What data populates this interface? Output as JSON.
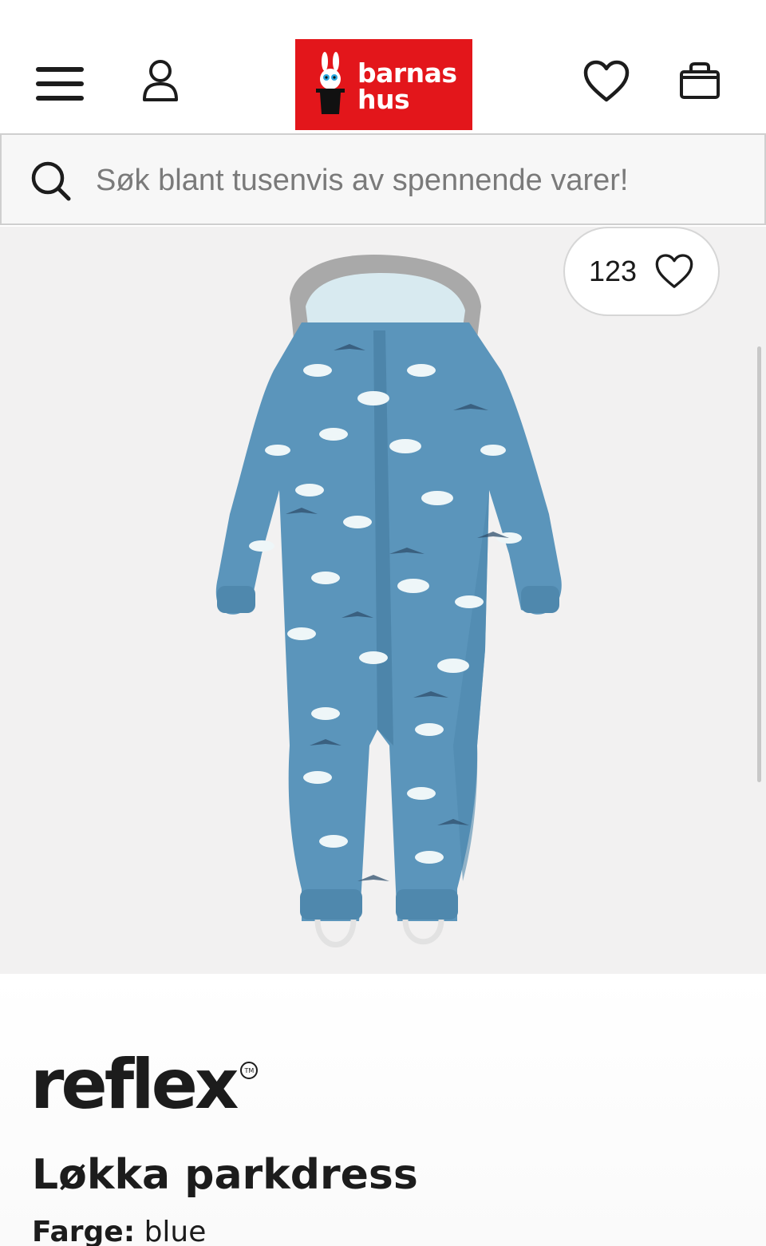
{
  "header": {
    "logo_line1": "barnas",
    "logo_line2": "hus",
    "menu_icon": "hamburger-menu-icon",
    "account_icon": "user-icon",
    "favorites_icon": "heart-icon",
    "cart_icon": "shopping-bag-icon",
    "brand_color": "#e3161b"
  },
  "search": {
    "placeholder": "Søk blant tusenvis av spennende varer!",
    "icon": "search-icon"
  },
  "gallery": {
    "wishlist_count": "123",
    "wishlist_icon": "heart-icon"
  },
  "product": {
    "brand": "reflex",
    "brand_tm": "TM",
    "title": "Løkka parkdress",
    "color_label": "Farge:",
    "color_value": "blue"
  }
}
